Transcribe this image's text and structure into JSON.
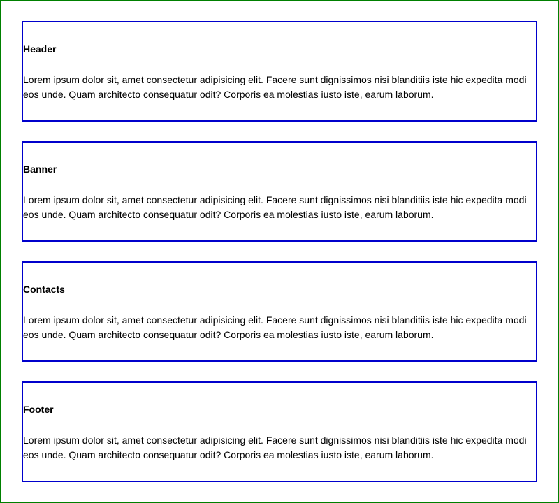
{
  "sections": [
    {
      "title": "Header",
      "text": "Lorem ipsum dolor sit, amet consectetur adipisicing elit. Facere sunt dignissimos nisi blanditiis iste hic expedita modi eos unde. Quam architecto consequatur odit? Corporis ea molestias iusto iste, earum laborum."
    },
    {
      "title": "Banner",
      "text": "Lorem ipsum dolor sit, amet consectetur adipisicing elit. Facere sunt dignissimos nisi blanditiis iste hic expedita modi eos unde. Quam architecto consequatur odit? Corporis ea molestias iusto iste, earum laborum."
    },
    {
      "title": "Contacts",
      "text": "Lorem ipsum dolor sit, amet consectetur adipisicing elit. Facere sunt dignissimos nisi blanditiis iste hic expedita modi eos unde. Quam architecto consequatur odit? Corporis ea molestias iusto iste, earum laborum."
    },
    {
      "title": "Footer",
      "text": "Lorem ipsum dolor sit, amet consectetur adipisicing elit. Facere sunt dignissimos nisi blanditiis iste hic expedita modi eos unde. Quam architecto consequatur odit? Corporis ea molestias iusto iste, earum laborum."
    }
  ],
  "colors": {
    "outer_border": "#008000",
    "section_border": "#0000cc",
    "text": "#000000",
    "background": "#ffffff"
  }
}
